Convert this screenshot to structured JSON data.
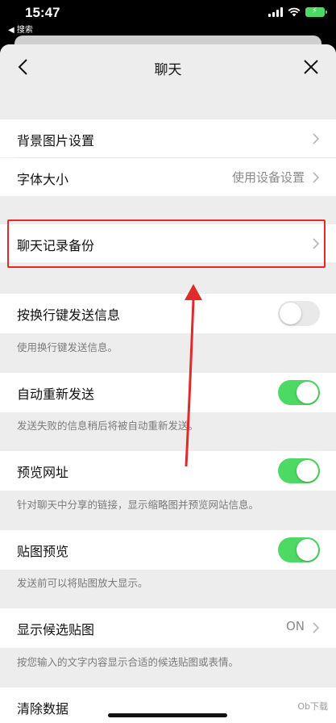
{
  "status_bar": {
    "time": "15:47",
    "back_to": "◀ 搜索"
  },
  "nav": {
    "title": "聊天"
  },
  "rows": {
    "bg_image": "背景图片设置",
    "font_size": "字体大小",
    "font_size_value": "使用设备设置",
    "backup": "聊天记录备份",
    "enter_send": "按换行键发送信息",
    "enter_send_hint": "使用换行键发送信息。",
    "auto_resend": "自动重新发送",
    "auto_resend_hint": "发送失败的信息稍后将被自动重新发送。",
    "preview_url": "预览网址",
    "preview_url_hint": "针对聊天中分享的链接，显示缩略图并预览网站信息。",
    "sticker_preview": "贴图预览",
    "sticker_preview_hint": "发送前可以将贴图放大显示。",
    "suggest_sticker": "显示候选贴图",
    "suggest_sticker_value": "ON",
    "suggest_sticker_hint": "按您输入的文字内容显示合适的候选贴图或表情。",
    "clear_data": "清除数据"
  },
  "toggles": {
    "enter_send": false,
    "auto_resend": true,
    "preview_url": true,
    "sticker_preview": true
  },
  "watermark": "Ob下载",
  "colors": {
    "toggle_on": "#4cd964",
    "highlight": "#e02b2b"
  }
}
